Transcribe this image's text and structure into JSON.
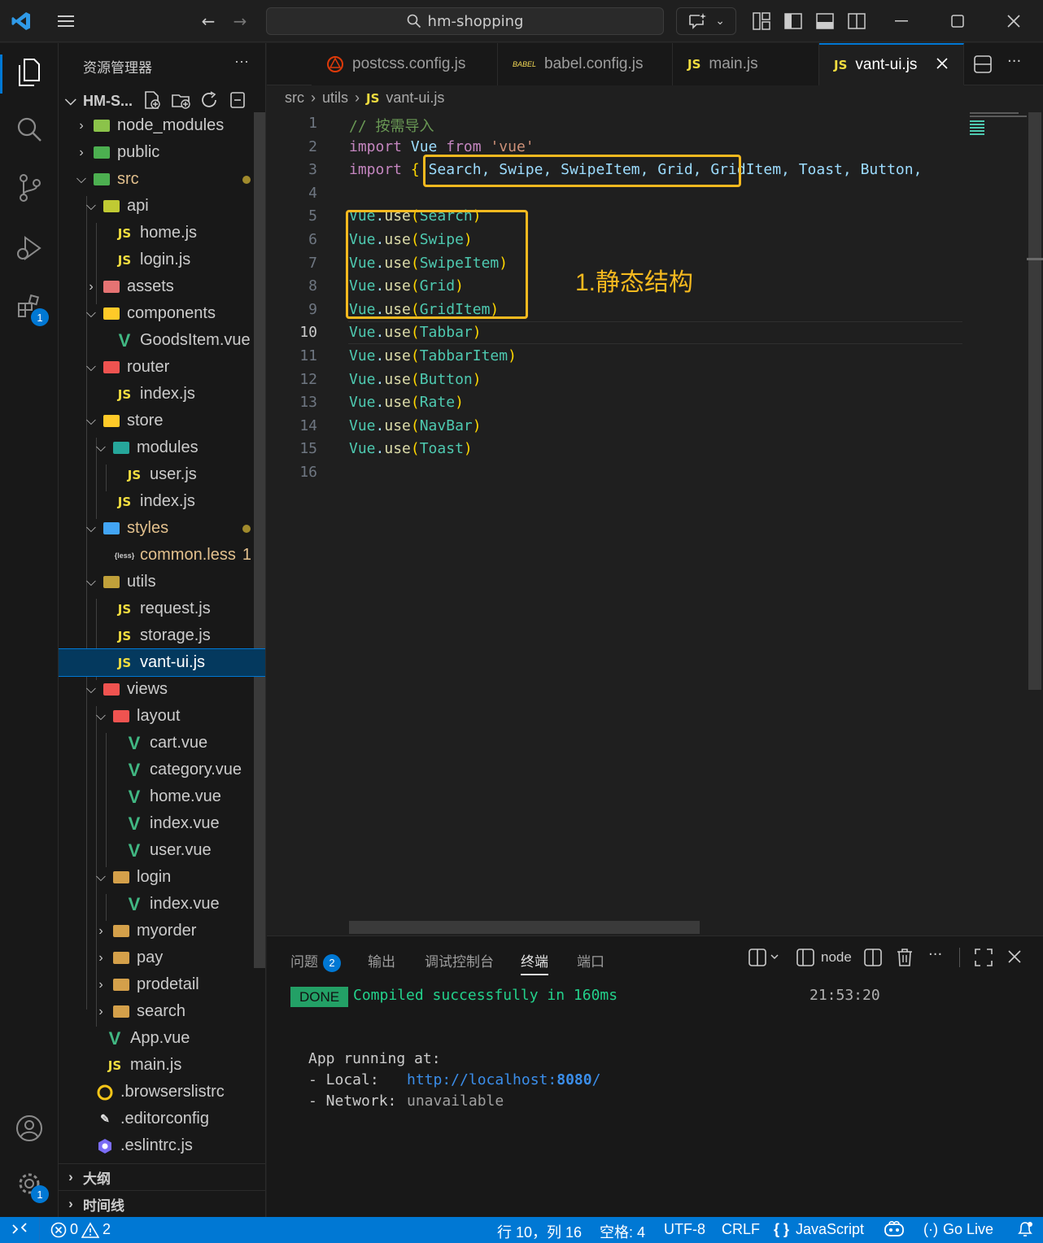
{
  "titlebar": {
    "search_text": "hm-shopping"
  },
  "activity_bar": {
    "extensions_badge": "1",
    "settings_badge": "1"
  },
  "sidebar": {
    "title": "资源管理器",
    "more": "···",
    "project": "HM-S...",
    "items": [
      {
        "label": "node_modules"
      },
      {
        "label": "public"
      },
      {
        "label": "src"
      },
      {
        "label": "api"
      },
      {
        "label": "home.js"
      },
      {
        "label": "login.js"
      },
      {
        "label": "assets"
      },
      {
        "label": "components"
      },
      {
        "label": "GoodsItem.vue"
      },
      {
        "label": "router"
      },
      {
        "label": "index.js"
      },
      {
        "label": "store"
      },
      {
        "label": "modules"
      },
      {
        "label": "user.js"
      },
      {
        "label": "index.js"
      },
      {
        "label": "styles"
      },
      {
        "label": "common.less",
        "problems": "1"
      },
      {
        "label": "utils"
      },
      {
        "label": "request.js"
      },
      {
        "label": "storage.js"
      },
      {
        "label": "vant-ui.js"
      },
      {
        "label": "views"
      },
      {
        "label": "layout"
      },
      {
        "label": "cart.vue"
      },
      {
        "label": "category.vue"
      },
      {
        "label": "home.vue"
      },
      {
        "label": "index.vue"
      },
      {
        "label": "user.vue"
      },
      {
        "label": "login"
      },
      {
        "label": "index.vue"
      },
      {
        "label": "myorder"
      },
      {
        "label": "pay"
      },
      {
        "label": "prodetail"
      },
      {
        "label": "search"
      },
      {
        "label": "App.vue"
      },
      {
        "label": "main.js"
      },
      {
        "label": ".browserslistrc"
      },
      {
        "label": ".editorconfig"
      },
      {
        "label": ".eslintrc.js"
      }
    ],
    "outline": "大纲",
    "timeline": "时间线"
  },
  "tabs": [
    {
      "label": "postcss.config.js"
    },
    {
      "label": "babel.config.js",
      "icon_text": "BABEL"
    },
    {
      "label": "main.js"
    },
    {
      "label": "vant-ui.js"
    }
  ],
  "breadcrumb": {
    "p1": "src",
    "p2": "utils",
    "p3": "vant-ui.js"
  },
  "code": {
    "line_numbers": [
      "1",
      "2",
      "3",
      "4",
      "5",
      "6",
      "7",
      "8",
      "9",
      "10",
      "11",
      "12",
      "13",
      "14",
      "15",
      "16"
    ],
    "comment": "// 按需导入",
    "import_kw": "import",
    "vue_ident": "Vue",
    "from_kw": "from",
    "vue_str": "'vue'",
    "line3_rest": "Search, Swipe, SwipeItem, Grid, GridItem, Toast, Button,",
    "use_components": [
      "Search",
      "Swipe",
      "SwipeItem",
      "Grid",
      "GridItem",
      "Tabbar",
      "TabbarItem",
      "Button",
      "Rate",
      "NavBar",
      "Toast"
    ]
  },
  "annotation": "1.静态结构",
  "panel": {
    "tabs": [
      {
        "label": "问题",
        "badge": "2"
      },
      {
        "label": "输出"
      },
      {
        "label": "调试控制台"
      },
      {
        "label": "终端"
      },
      {
        "label": "端口"
      }
    ],
    "terminal_name": "node",
    "done": "DONE",
    "compiled": "Compiled successfully in 160ms",
    "time": "21:53:20",
    "app_running": "App running at:",
    "local_label": "- Local:",
    "local_url_prefix": "http://localhost:",
    "local_url_port": "8080",
    "local_url_suffix": "/",
    "network_label": "- Network:",
    "network_value": "unavailable"
  },
  "statusbar": {
    "errors": "0",
    "warnings": "2",
    "position": "行 10，列 16",
    "spaces": "空格: 4",
    "encoding": "UTF-8",
    "eol": "CRLF",
    "language": "JavaScript",
    "golive": "Go Live"
  },
  "colors": {
    "accent": "#0078d4",
    "highlight_box": "#f5b91f",
    "done_bg": "#23a066"
  }
}
